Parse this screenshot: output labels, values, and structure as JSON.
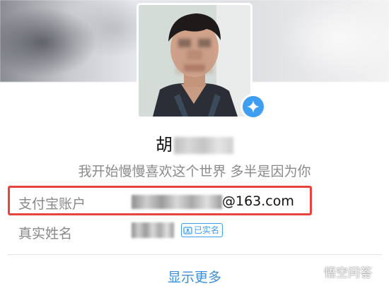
{
  "profile": {
    "name_visible": "胡",
    "bio": "我开始慢慢喜欢这个世界 多半是因为你"
  },
  "info_rows": {
    "alipay_label": "支付宝账户",
    "alipay_suffix": "@163.com",
    "realname_label": "真实姓名",
    "verified_badge": "已实名"
  },
  "actions": {
    "show_more": "显示更多"
  },
  "watermark": {
    "text": "悟空问答"
  },
  "icons": {
    "verify": "sparkle-star-icon",
    "badge": "id-card-icon",
    "watermark": "wukong-logo-icon"
  },
  "colors": {
    "accent": "#3d9ef2",
    "link": "#3d8ed8",
    "highlight": "#e8443b"
  }
}
